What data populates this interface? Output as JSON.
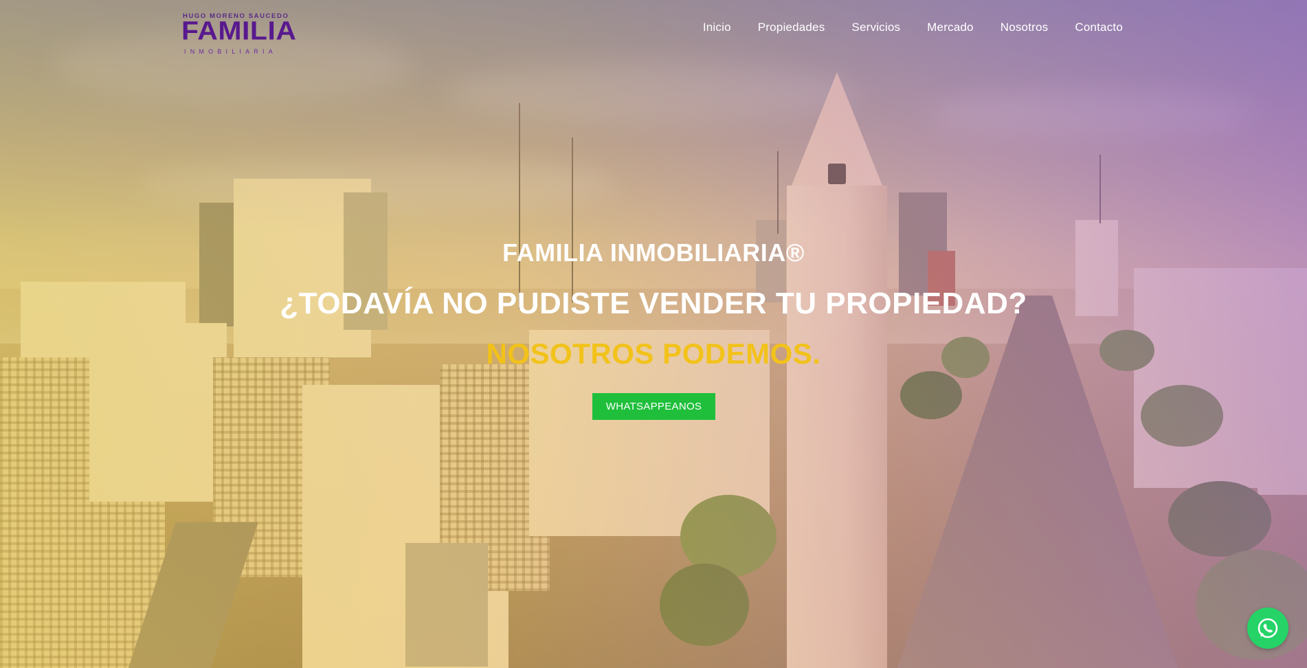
{
  "brand": {
    "logo_top": "HUGO MORENO SAUCEDO",
    "logo_main": "FAMILIA",
    "logo_sub": "INMOBILIARIA",
    "primary_color": "#58198e"
  },
  "nav": {
    "items": [
      {
        "label": "Inicio"
      },
      {
        "label": "Propiedades"
      },
      {
        "label": "Servicios"
      },
      {
        "label": "Mercado"
      },
      {
        "label": "Nosotros"
      },
      {
        "label": "Contacto"
      }
    ]
  },
  "hero": {
    "kicker": "FAMILIA INMOBILIARIA®",
    "headline": "¿TODAVÍA NO PUDISTE VENDER TU PROPIEDAD?",
    "tagline": "NOSOTROS PODEMOS.",
    "tagline_color": "#f2c21a",
    "cta_label": "WHATSAPPEANOS",
    "cta_color": "#1fbf3b"
  },
  "floating": {
    "icon": "whatsapp-icon",
    "color": "#25d366"
  }
}
